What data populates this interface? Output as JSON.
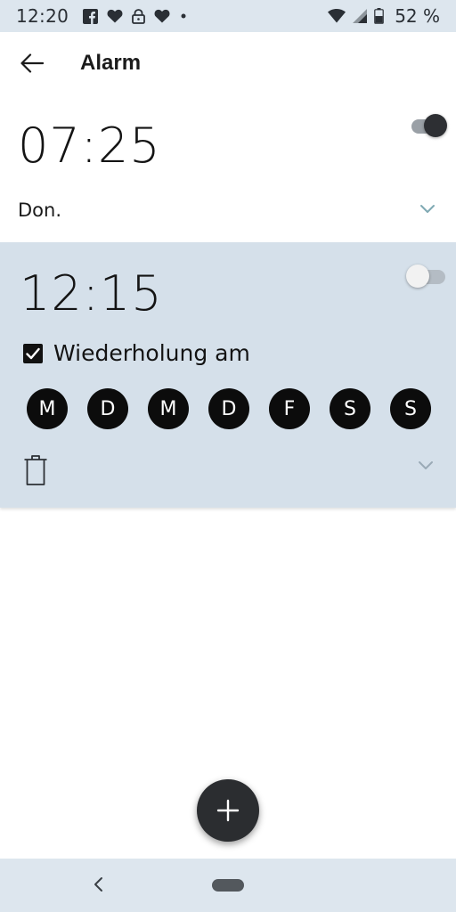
{
  "status_bar": {
    "time": "12:20",
    "battery_text": "52 %",
    "icons": [
      "facebook-icon",
      "heart-icon",
      "lock-icon",
      "heart-icon",
      "dot-icon",
      "wifi-icon",
      "signal-icon",
      "battery-icon"
    ]
  },
  "header": {
    "title": "Alarm"
  },
  "alarms": [
    {
      "time": "07:25",
      "days_text": "Don.",
      "enabled": true
    },
    {
      "time": "12:15",
      "enabled": false,
      "repeat_label": "Wiederholung am",
      "repeat_checked": true,
      "days": [
        "M",
        "D",
        "M",
        "D",
        "F",
        "S",
        "S"
      ]
    }
  ],
  "colors": {
    "status_bar_bg": "#dde6ee",
    "expanded_card_bg": "#d5e0ea",
    "accent_dark": "#2b2d30",
    "chevron_teal": "#7fa9b3"
  }
}
